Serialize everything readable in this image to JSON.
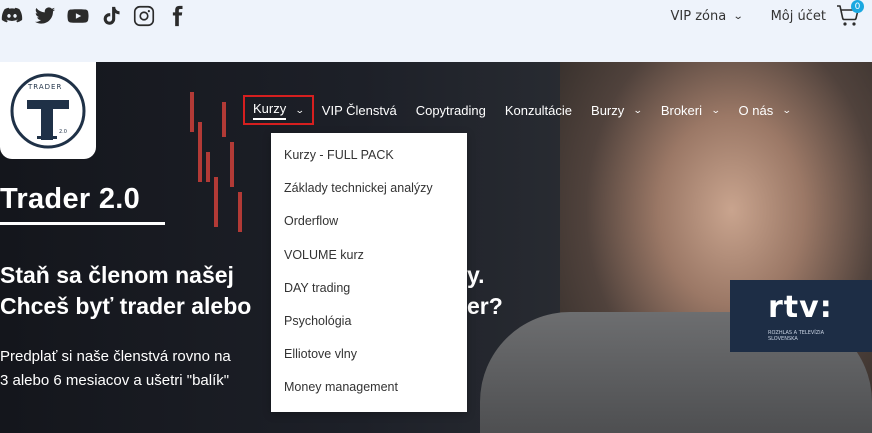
{
  "social": {
    "icons": [
      "discord-icon",
      "twitter-icon",
      "youtube-icon",
      "tiktok-icon",
      "instagram-icon",
      "facebook-icon"
    ]
  },
  "account": {
    "vip_zona": "VIP zóna",
    "moj_ucet": "Môj účet",
    "cart_count": "0"
  },
  "logo": {
    "text": "TRADER",
    "version": "2.0"
  },
  "nav": {
    "items": [
      {
        "label": "Kurzy",
        "dropdown": true
      },
      {
        "label": "VIP Členstvá",
        "dropdown": false
      },
      {
        "label": "Copytrading",
        "dropdown": false
      },
      {
        "label": "Konzultácie",
        "dropdown": false
      },
      {
        "label": "Burzy",
        "dropdown": true
      },
      {
        "label": "Brokeri",
        "dropdown": true
      },
      {
        "label": "O nás",
        "dropdown": true
      }
    ]
  },
  "dropdown": {
    "items": [
      "Kurzy - FULL PACK",
      "Základy technickej analýzy",
      "Orderflow",
      "VOLUME kurz",
      "DAY trading",
      "Psychológia",
      "Elliotove vlny",
      "Money management"
    ]
  },
  "hero": {
    "title": "Trader 2.0",
    "sub_line1": "Staň sa členom našej",
    "sub_line1_tail": "y.",
    "sub_line2": "Chceš byť trader alebo",
    "sub_line2_tail": "er?",
    "desc_line1": "Predplať si naše členstvá rovno na",
    "desc_line2": "3 alebo 6 mesiacov a ušetri \"balík\""
  },
  "tv": {
    "logo": "rtv:",
    "sub": "ROZHLAS A TELEVÍZIA SLOVENSKA"
  },
  "colors": {
    "accent_red": "#d61f1f",
    "cart_badge": "#1ba8e0",
    "topbar_bg": "#eef3fb"
  }
}
